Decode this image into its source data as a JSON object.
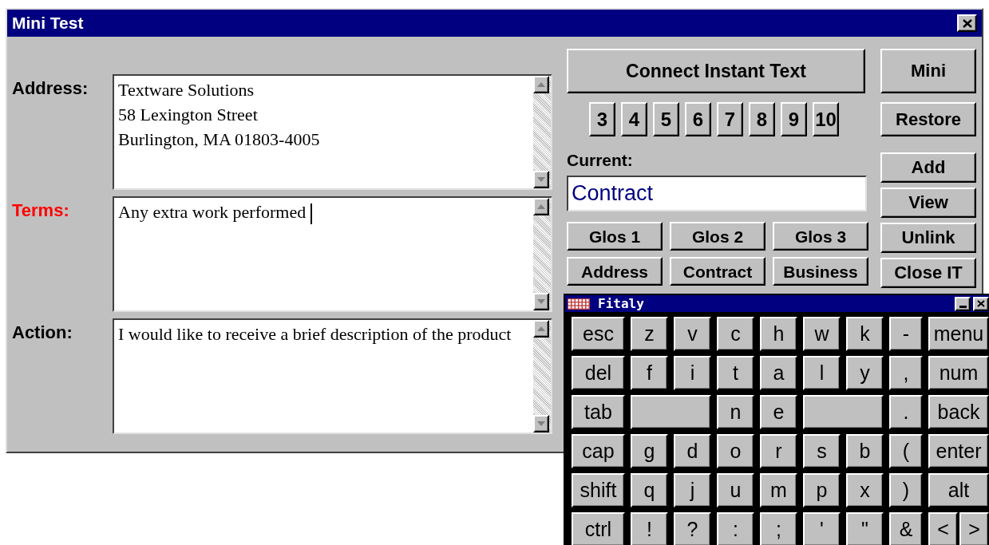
{
  "window": {
    "title": "Mini Test"
  },
  "fields": [
    {
      "label": "Address:",
      "selected": false,
      "lines": [
        "Textware Solutions",
        "58 Lexington Street",
        "Burlington, MA 01803-4005"
      ]
    },
    {
      "label": "Terms:",
      "selected": true,
      "lines": [
        "Any extra work performed "
      ]
    },
    {
      "label": "Action:",
      "selected": false,
      "lines": [
        "I would like to receive a brief description of the product"
      ]
    }
  ],
  "panel": {
    "connect_button": "Connect Instant Text",
    "mini_button": "Mini",
    "page_buttons": [
      "3",
      "4",
      "5",
      "6",
      "7",
      "8",
      "9",
      "10"
    ],
    "restore_button": "Restore",
    "current": {
      "label": "Current:",
      "value": "Contract"
    },
    "side_buttons": [
      "Add",
      "View",
      "Unlink",
      "Close IT"
    ],
    "glossary_buttons": [
      [
        "Glos 1",
        "Glos 2",
        "Glos 3"
      ],
      [
        "Address",
        "Contract",
        "Business"
      ]
    ]
  },
  "keyboard": {
    "title": "Fitaly",
    "rows": [
      [
        {
          "kind": "key",
          "label": "esc"
        },
        {
          "kind": "key",
          "label": "z"
        },
        {
          "kind": "key",
          "label": "v"
        },
        {
          "kind": "key",
          "label": "c"
        },
        {
          "kind": "key",
          "label": "h"
        },
        {
          "kind": "key",
          "label": "w"
        },
        {
          "kind": "key",
          "label": "k"
        },
        {
          "kind": "key",
          "label": "-"
        },
        {
          "kind": "key",
          "label": "menu"
        }
      ],
      [
        {
          "kind": "key",
          "label": "del"
        },
        {
          "kind": "key",
          "label": "f"
        },
        {
          "kind": "key",
          "label": "i"
        },
        {
          "kind": "key",
          "label": "t"
        },
        {
          "kind": "key",
          "label": "a"
        },
        {
          "kind": "key",
          "label": "l"
        },
        {
          "kind": "key",
          "label": "y"
        },
        {
          "kind": "key",
          "label": ","
        },
        {
          "kind": "key",
          "label": "num"
        }
      ],
      [
        {
          "kind": "key",
          "label": "tab"
        },
        {
          "kind": "blank"
        },
        {
          "kind": "span"
        },
        {
          "kind": "key",
          "label": "n"
        },
        {
          "kind": "key",
          "label": "e"
        },
        {
          "kind": "blank"
        },
        {
          "kind": "span"
        },
        {
          "kind": "key",
          "label": "."
        },
        {
          "kind": "key",
          "label": "back"
        }
      ],
      [
        {
          "kind": "key",
          "label": "cap"
        },
        {
          "kind": "key",
          "label": "g"
        },
        {
          "kind": "key",
          "label": "d"
        },
        {
          "kind": "key",
          "label": "o"
        },
        {
          "kind": "key",
          "label": "r"
        },
        {
          "kind": "key",
          "label": "s"
        },
        {
          "kind": "key",
          "label": "b"
        },
        {
          "kind": "key",
          "label": "("
        },
        {
          "kind": "key",
          "label": "enter"
        }
      ],
      [
        {
          "kind": "key",
          "label": "shift"
        },
        {
          "kind": "key",
          "label": "q"
        },
        {
          "kind": "key",
          "label": "j"
        },
        {
          "kind": "key",
          "label": "u"
        },
        {
          "kind": "key",
          "label": "m"
        },
        {
          "kind": "key",
          "label": "p"
        },
        {
          "kind": "key",
          "label": "x"
        },
        {
          "kind": "key",
          "label": ")"
        },
        {
          "kind": "key",
          "label": "alt"
        }
      ],
      [
        {
          "kind": "key",
          "label": "ctrl"
        },
        {
          "kind": "key",
          "label": "!"
        },
        {
          "kind": "key",
          "label": "?"
        },
        {
          "kind": "key",
          "label": ":"
        },
        {
          "kind": "key",
          "label": ";"
        },
        {
          "kind": "key",
          "label": "'"
        },
        {
          "kind": "key",
          "label": "\""
        },
        {
          "kind": "key",
          "label": "&"
        },
        {
          "kind": "half",
          "label": "<"
        },
        {
          "kind": "half",
          "label": ">"
        }
      ]
    ]
  }
}
